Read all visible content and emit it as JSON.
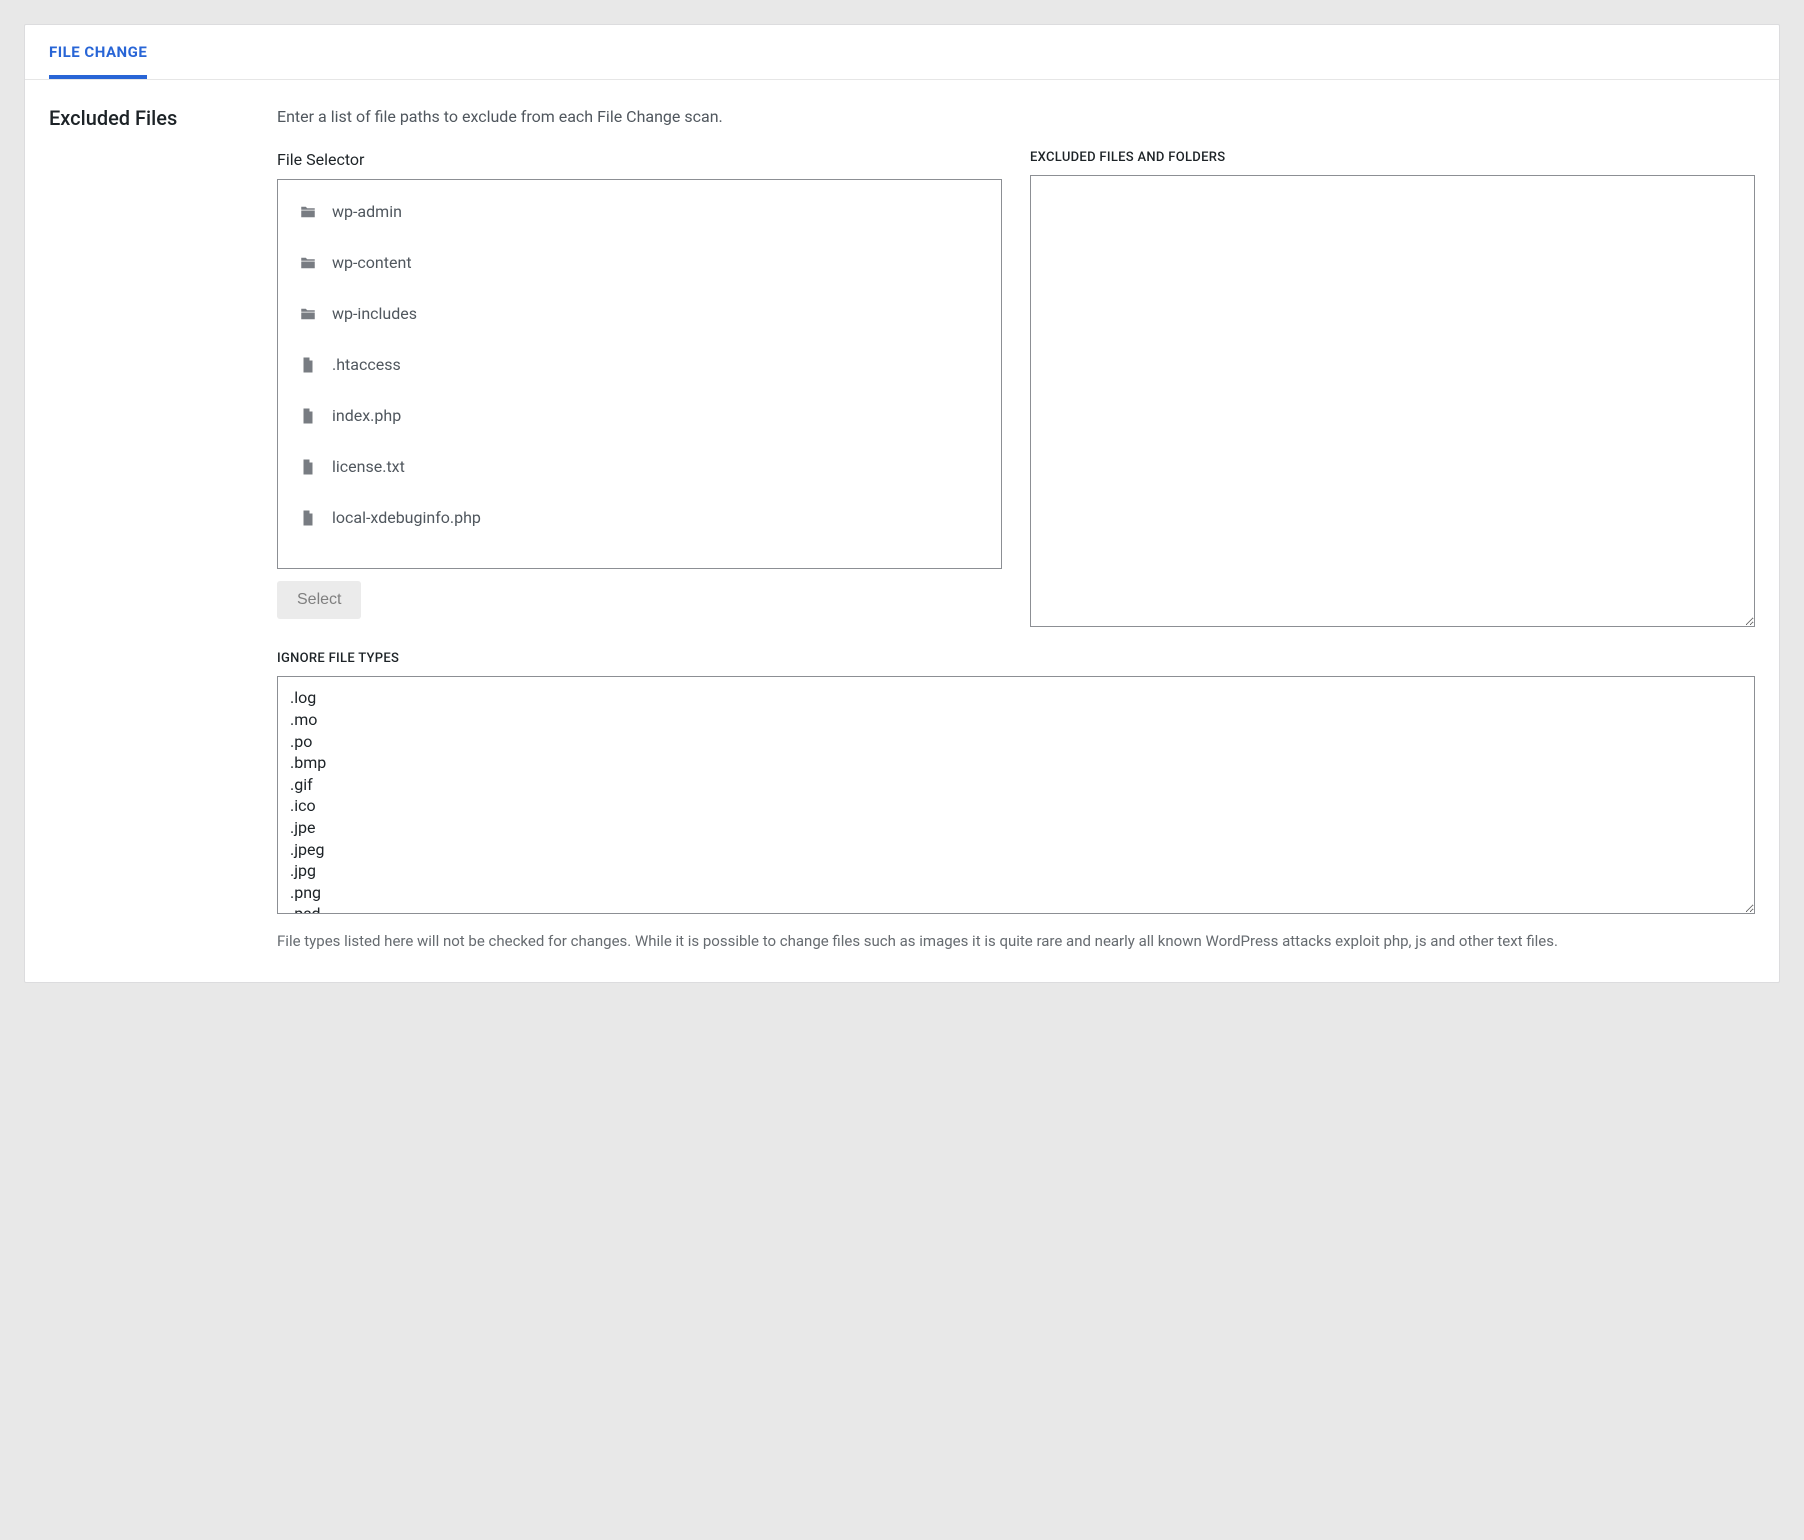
{
  "tab": {
    "label": "FILE CHANGE"
  },
  "section": {
    "title": "Excluded Files",
    "description": "Enter a list of file paths to exclude from each File Change scan."
  },
  "fileSelector": {
    "label": "File Selector",
    "items": [
      {
        "type": "folder",
        "name": "wp-admin"
      },
      {
        "type": "folder",
        "name": "wp-content"
      },
      {
        "type": "folder",
        "name": "wp-includes"
      },
      {
        "type": "file",
        "name": ".htaccess"
      },
      {
        "type": "file",
        "name": "index.php"
      },
      {
        "type": "file",
        "name": "license.txt"
      },
      {
        "type": "file",
        "name": "local-xdebuginfo.php"
      }
    ],
    "selectButton": "Select"
  },
  "excluded": {
    "label": "EXCLUDED FILES AND FOLDERS",
    "value": ""
  },
  "ignore": {
    "label": "IGNORE FILE TYPES",
    "value": ".log\n.mo\n.po\n.bmp\n.gif\n.ico\n.jpe\n.jpeg\n.jpg\n.png\n.psd",
    "help": "File types listed here will not be checked for changes. While it is possible to change files such as images it is quite rare and nearly all known WordPress attacks exploit php, js and other text files."
  }
}
